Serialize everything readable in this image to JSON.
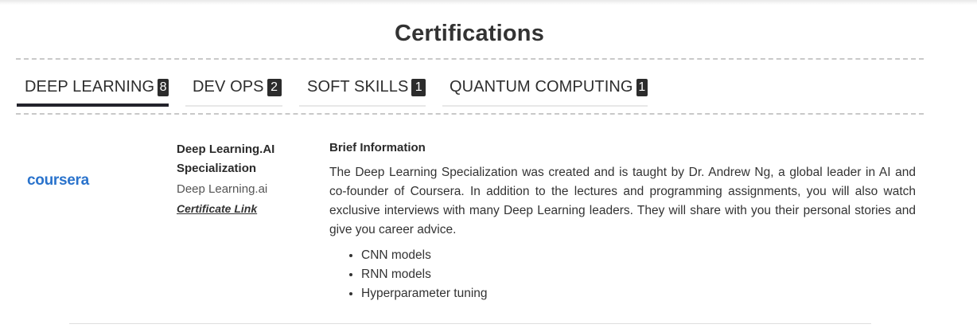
{
  "section": {
    "title": "Certifications"
  },
  "tabs": [
    {
      "label": "DEEP LEARNING",
      "count": "8",
      "active": true
    },
    {
      "label": "DEV OPS",
      "count": "2",
      "active": false
    },
    {
      "label": "SOFT SKILLS",
      "count": "1",
      "active": false
    },
    {
      "label": "QUANTUM COMPUTING",
      "count": "1",
      "active": false
    }
  ],
  "certificate": {
    "logo_text": "coursera",
    "title": "Deep Learning.AI Specialization",
    "issuer": "Deep Learning.ai",
    "link_label": "Certificate Link",
    "brief_heading": "Brief Information",
    "brief_text": "The Deep Learning Specialization was created and is taught by Dr. Andrew Ng, a global leader in AI and co-founder of Coursera. In addition to the lectures and programming assignments, you will also watch exclusive interviews with many Deep Learning leaders. They will share with you their personal stories and give you career advice.",
    "topics": [
      "CNN models",
      "RNN models",
      "Hyperparameter tuning"
    ]
  },
  "colors": {
    "accent": "#23232b",
    "coursera_blue": "#2a73cc",
    "badge": "#2c2c2c"
  }
}
